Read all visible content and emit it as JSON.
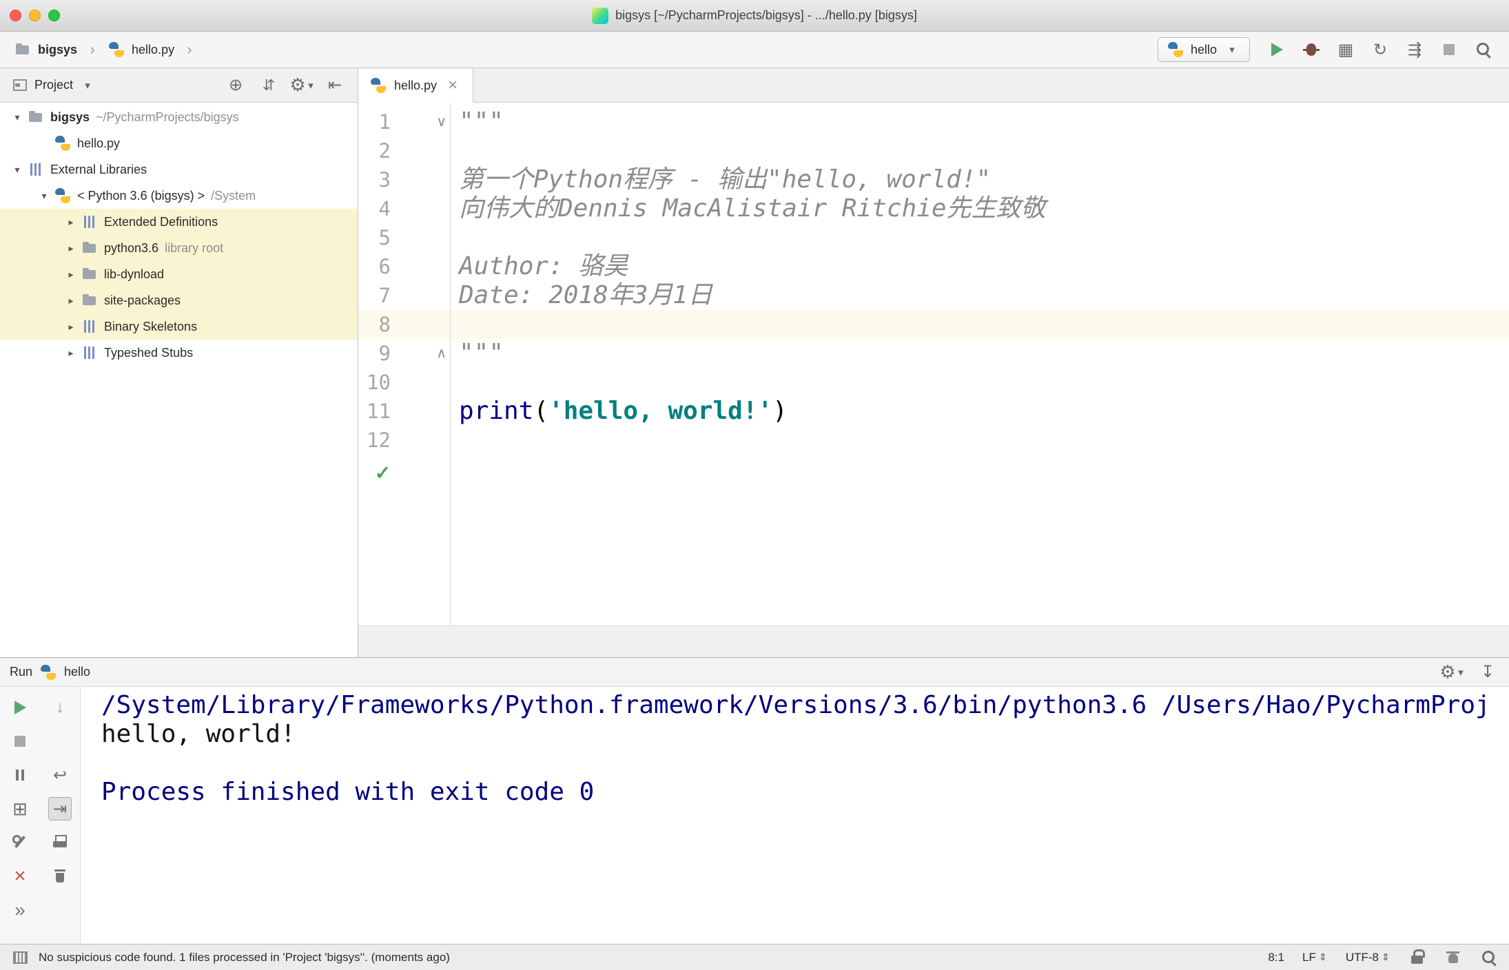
{
  "colors": {
    "run_green": "#59A869",
    "error_red": "#C75450",
    "library_highlight": "#F9F4D2",
    "current_line": "#FCFAEC",
    "string_teal": "#008080",
    "keyword_navy": "#000080",
    "doc_gray": "#8C8C8C"
  },
  "titlebar": {
    "title": "bigsys [~/PycharmProjects/bigsys] - .../hello.py [bigsys]"
  },
  "navbar": {
    "breadcrumbs": {
      "root": "bigsys",
      "file": "hello.py"
    },
    "run_config": "hello",
    "actions": [
      {
        "name": "run-button",
        "icon": "play"
      },
      {
        "name": "debug-button",
        "icon": "bug"
      },
      {
        "name": "run-with-coverage-button",
        "icon": "coverage"
      },
      {
        "name": "profiler-button",
        "icon": "profiler"
      },
      {
        "name": "concurrency-diagram-button",
        "icon": "concurrency"
      },
      {
        "name": "stop-button",
        "icon": "stop-sq"
      },
      {
        "name": "search-everywhere-button",
        "icon": "search"
      }
    ]
  },
  "project": {
    "title": "Project",
    "tree": [
      {
        "label": "bigsys",
        "suffix": "~/PycharmProjects/bigsys",
        "icon": "folder",
        "level": 0,
        "expanded": true,
        "bold": true
      },
      {
        "label": "hello.py",
        "icon": "python",
        "level": 1
      },
      {
        "label": "External Libraries",
        "icon": "library",
        "level": 0,
        "expanded": true
      },
      {
        "label": "< Python 3.6 (bigsys) >",
        "suffix": "/System",
        "icon": "python",
        "level": 1,
        "expanded": true
      },
      {
        "label": "Extended Definitions",
        "icon": "library",
        "level": 2,
        "expanded": false,
        "highlight": true
      },
      {
        "label": "python3.6",
        "suffix": "library root",
        "icon": "folder",
        "level": 2,
        "expanded": false,
        "highlight": true
      },
      {
        "label": "lib-dynload",
        "icon": "folder",
        "level": 2,
        "expanded": false,
        "highlight": true
      },
      {
        "label": "site-packages",
        "icon": "folder",
        "level": 2,
        "expanded": false,
        "highlight": true
      },
      {
        "label": "Binary Skeletons",
        "icon": "library",
        "level": 2,
        "expanded": false,
        "highlight": true
      },
      {
        "label": "Typeshed Stubs",
        "icon": "library",
        "level": 2,
        "expanded": false
      }
    ]
  },
  "editor": {
    "tab": "hello.py",
    "lines": [
      {
        "n": 1,
        "fold": "down",
        "segs": [
          [
            "doc",
            "\"\"\""
          ]
        ]
      },
      {
        "n": 2,
        "segs": []
      },
      {
        "n": 3,
        "segs": [
          [
            "doc",
            "第一个Python程序 - 输出\"hello, world!\""
          ]
        ]
      },
      {
        "n": 4,
        "segs": [
          [
            "doc",
            "向伟大的Dennis MacAlistair Ritchie先生致敬"
          ]
        ]
      },
      {
        "n": 5,
        "segs": []
      },
      {
        "n": 6,
        "segs": [
          [
            "doc",
            "Author: 骆昊"
          ]
        ]
      },
      {
        "n": 7,
        "segs": [
          [
            "doc",
            "Date: 2018年3月1日"
          ]
        ]
      },
      {
        "n": 8,
        "current": true,
        "segs": []
      },
      {
        "n": 9,
        "fold": "up",
        "segs": [
          [
            "doc",
            "\"\"\""
          ]
        ]
      },
      {
        "n": 10,
        "segs": []
      },
      {
        "n": 11,
        "segs": [
          [
            "kw",
            "print"
          ],
          [
            "plain",
            "("
          ],
          [
            "str",
            "'hello, world!'"
          ],
          [
            "plain",
            ")"
          ]
        ]
      },
      {
        "n": 12,
        "segs": []
      }
    ]
  },
  "run_panel": {
    "title": "Run",
    "config": "hello",
    "toolbar_left": [
      {
        "name": "rerun-button",
        "icon": "play"
      },
      {
        "name": "stop-button",
        "icon": "stop-sq"
      },
      {
        "name": "pause-output-button",
        "icon": "pause"
      },
      {
        "name": "restore-layout-button",
        "icon": "restore"
      },
      {
        "name": "edit-configurations-button",
        "icon": "tools"
      },
      {
        "name": "close-button",
        "icon": "close-red"
      },
      {
        "name": "more-options-button",
        "icon": "more"
      }
    ],
    "toolbar_console": [
      {
        "name": "down-the-stack-button",
        "icon": "down"
      },
      {
        "spacer": true
      },
      {
        "name": "soft-wrap-button",
        "icon": "softwrap"
      },
      {
        "name": "scroll-to-end-button",
        "icon": "scrollend",
        "selected": true
      },
      {
        "name": "print-button",
        "icon": "print"
      },
      {
        "name": "clear-all-button",
        "icon": "trash"
      }
    ],
    "console": [
      {
        "style": "system",
        "text": "/System/Library/Frameworks/Python.framework/Versions/3.6/bin/python3.6 /Users/Hao/PycharmProj"
      },
      {
        "style": "stdout",
        "text": "hello, world!"
      },
      {
        "style": "stdout",
        "text": ""
      },
      {
        "style": "system",
        "text": "Process finished with exit code 0"
      }
    ]
  },
  "statusbar": {
    "message": "No suspicious code found. 1 files processed in 'Project 'bigsys''. (moments ago)",
    "caret": "8:1",
    "line_separator": "LF",
    "encoding": "UTF-8"
  }
}
